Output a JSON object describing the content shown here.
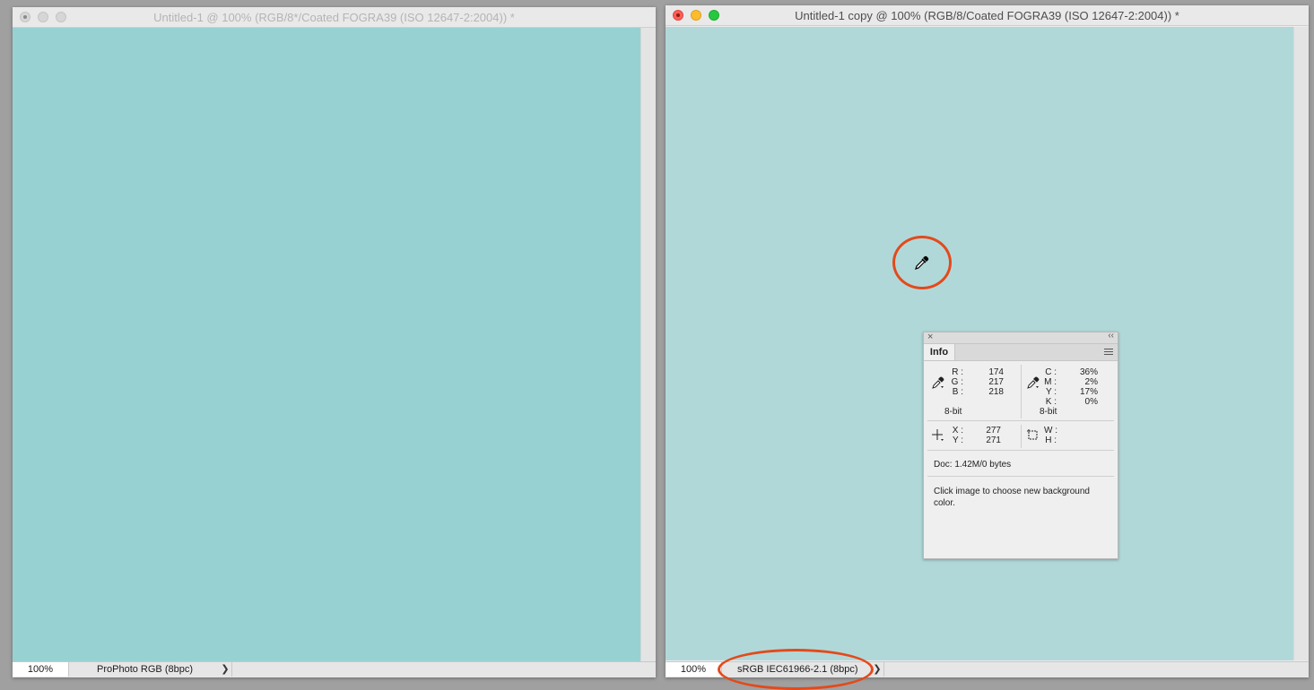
{
  "left_window": {
    "title": "Untitled-1 @ 100% (RGB/8*/Coated FOGRA39 (ISO 12647-2:2004)) *",
    "zoom": "100%",
    "profile": "ProPhoto RGB (8bpc)",
    "arrow": "❯",
    "canvas_color": "#97d1d2"
  },
  "right_window": {
    "title": "Untitled-1 copy @ 100% (RGB/8/Coated FOGRA39 (ISO 12647-2:2004)) *",
    "zoom": "100%",
    "profile": "sRGB IEC61966-2.1 (8bpc)",
    "arrow": "❯",
    "canvas_color": "#b1d8d9"
  },
  "info_panel": {
    "close_icon": "×",
    "collapse_icon": "‹‹",
    "tab_label": "Info",
    "rgb": {
      "r_label": "R :",
      "r_value": "174",
      "g_label": "G :",
      "g_value": "217",
      "b_label": "B :",
      "b_value": "218",
      "bit_depth": "8-bit"
    },
    "cmyk": {
      "c_label": "C :",
      "c_value": "36%",
      "m_label": "M :",
      "m_value": "2%",
      "y_label": "Y :",
      "y_value": "17%",
      "k_label": "K :",
      "k_value": "0%",
      "bit_depth": "8-bit"
    },
    "position": {
      "x_label": "X :",
      "x_value": "277",
      "y_label": "Y :",
      "y_value": "271"
    },
    "size": {
      "w_label": "W :",
      "w_value": "",
      "h_label": "H :",
      "h_value": ""
    },
    "doc": "Doc: 1.42M/0 bytes",
    "hint": "Click image to choose new background color."
  },
  "annotation_color": "#e34a1b",
  "icons": {
    "eyedropper": "eyedropper-icon",
    "crosshair": "crosshair-icon",
    "selection_box": "selection-box-icon",
    "panel_menu": "panel-menu-icon"
  }
}
